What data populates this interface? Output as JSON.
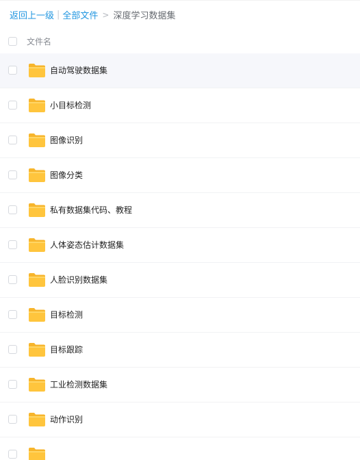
{
  "breadcrumb": {
    "back": "返回上一级",
    "divider": "|",
    "all_files": "全部文件",
    "separator": ">",
    "current": "深度学习数据集"
  },
  "header": {
    "column_name": "文件名"
  },
  "folders": [
    {
      "name": "自动驾驶数据集"
    },
    {
      "name": "小目标检测"
    },
    {
      "name": "图像识别"
    },
    {
      "name": "图像分类"
    },
    {
      "name": "私有数据集代码、教程"
    },
    {
      "name": "人体姿态估计数据集"
    },
    {
      "name": "人脸识别数据集"
    },
    {
      "name": "目标检测"
    },
    {
      "name": "目标跟踪"
    },
    {
      "name": "工业检测数据集"
    },
    {
      "name": "动作识别"
    },
    {
      "name": ""
    }
  ],
  "colors": {
    "link": "#2196e0",
    "folder_body": "#ffc53d",
    "folder_tab": "#f7b52c",
    "row_hover": "#f6f7fb"
  },
  "icons": {
    "folder": "folder-icon",
    "checkbox": "checkbox"
  }
}
